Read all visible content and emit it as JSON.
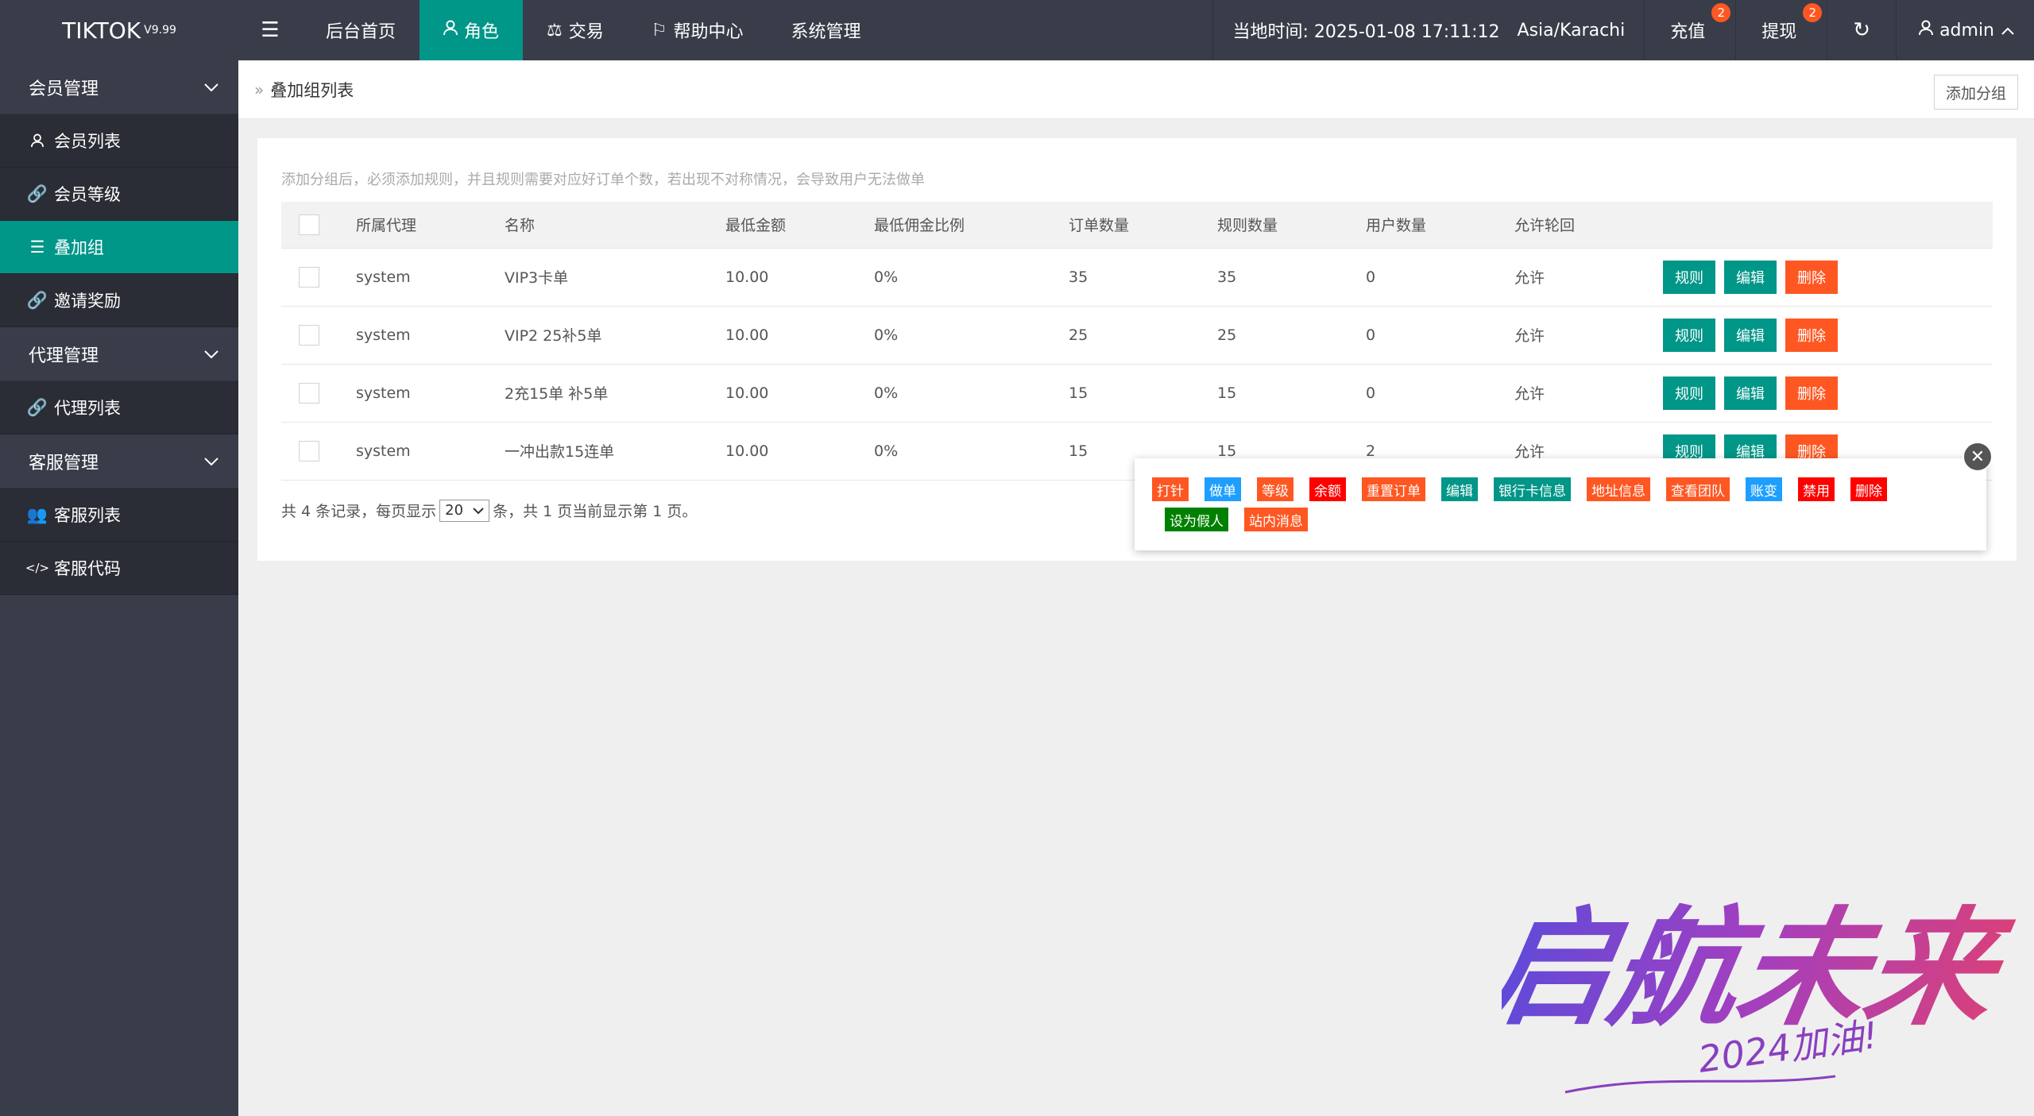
{
  "app": {
    "logo": "TIKTOK",
    "version": "V9.99"
  },
  "topnav": {
    "items": [
      {
        "label": "后台首页"
      },
      {
        "label": "角色"
      },
      {
        "label": "交易"
      },
      {
        "label": "帮助中心"
      },
      {
        "label": "系统管理"
      }
    ]
  },
  "topright": {
    "time": "当地时间: 2025-01-08 17:11:12",
    "timezone": "Asia/Karachi",
    "recharge": "充值",
    "recharge_badge": "2",
    "withdraw": "提现",
    "withdraw_badge": "2",
    "user": "admin"
  },
  "sidebar": {
    "groups": [
      {
        "label": "会员管理",
        "items": [
          {
            "label": "会员列表",
            "icon": "user-icon"
          },
          {
            "label": "会员等级",
            "icon": "link-icon"
          },
          {
            "label": "叠加组",
            "icon": "list-icon"
          },
          {
            "label": "邀请奖励",
            "icon": "link-icon"
          }
        ]
      },
      {
        "label": "代理管理",
        "items": [
          {
            "label": "代理列表",
            "icon": "link-icon"
          }
        ]
      },
      {
        "label": "客服管理",
        "items": [
          {
            "label": "客服列表",
            "icon": "users-icon"
          },
          {
            "label": "客服代码",
            "icon": "code-icon"
          }
        ]
      }
    ]
  },
  "page": {
    "breadcrumb": "叠加组列表",
    "add_button": "添加分组",
    "tip": "添加分组后，必须添加规则，并且规则需要对应好订单个数，若出现不对称情况，会导致用户无法做单"
  },
  "table": {
    "headers": [
      "所属代理",
      "名称",
      "最低金额",
      "最低佣金比例",
      "订单数量",
      "规则数量",
      "用户数量",
      "允许轮回"
    ],
    "rows": [
      [
        "system",
        "VIP3卡单",
        "10.00",
        "0%",
        "35",
        "35",
        "0",
        "允许"
      ],
      [
        "system",
        "VIP2 25补5单",
        "10.00",
        "0%",
        "25",
        "25",
        "0",
        "允许"
      ],
      [
        "system",
        "2充15单 补5单",
        "10.00",
        "0%",
        "15",
        "15",
        "0",
        "允许"
      ],
      [
        "system",
        "一冲出款15连单",
        "10.00",
        "0%",
        "15",
        "15",
        "2",
        "允许"
      ]
    ],
    "actions": {
      "rule": "规则",
      "edit": "编辑",
      "delete": "删除"
    }
  },
  "pager": {
    "prefix": "共 4 条记录，每页显示",
    "page_size": "20",
    "suffix": "条，共 1 页当前显示第 1 页。"
  },
  "popup": {
    "buttons": [
      {
        "label": "打针",
        "color": "#ff5722"
      },
      {
        "label": "做单",
        "color": "#1e9fff"
      },
      {
        "label": "等级",
        "color": "#ff5722"
      },
      {
        "label": "余额",
        "color": "#ff0000"
      },
      {
        "label": "重置订单",
        "color": "#ff5722"
      },
      {
        "label": "编辑",
        "color": "#009688"
      },
      {
        "label": "银行卡信息",
        "color": "#009688"
      },
      {
        "label": "地址信息",
        "color": "#ff5722"
      },
      {
        "label": "查看团队",
        "color": "#ff5722"
      },
      {
        "label": "账变",
        "color": "#1e9fff"
      },
      {
        "label": "禁用",
        "color": "#ff0000"
      },
      {
        "label": "删除",
        "color": "#ff0000"
      },
      {
        "label": "设为假人",
        "color": "#008000"
      },
      {
        "label": "站内消息",
        "color": "#ff5722"
      }
    ]
  },
  "watermark": {
    "text": "启航未来",
    "sub": "2024加油!"
  }
}
